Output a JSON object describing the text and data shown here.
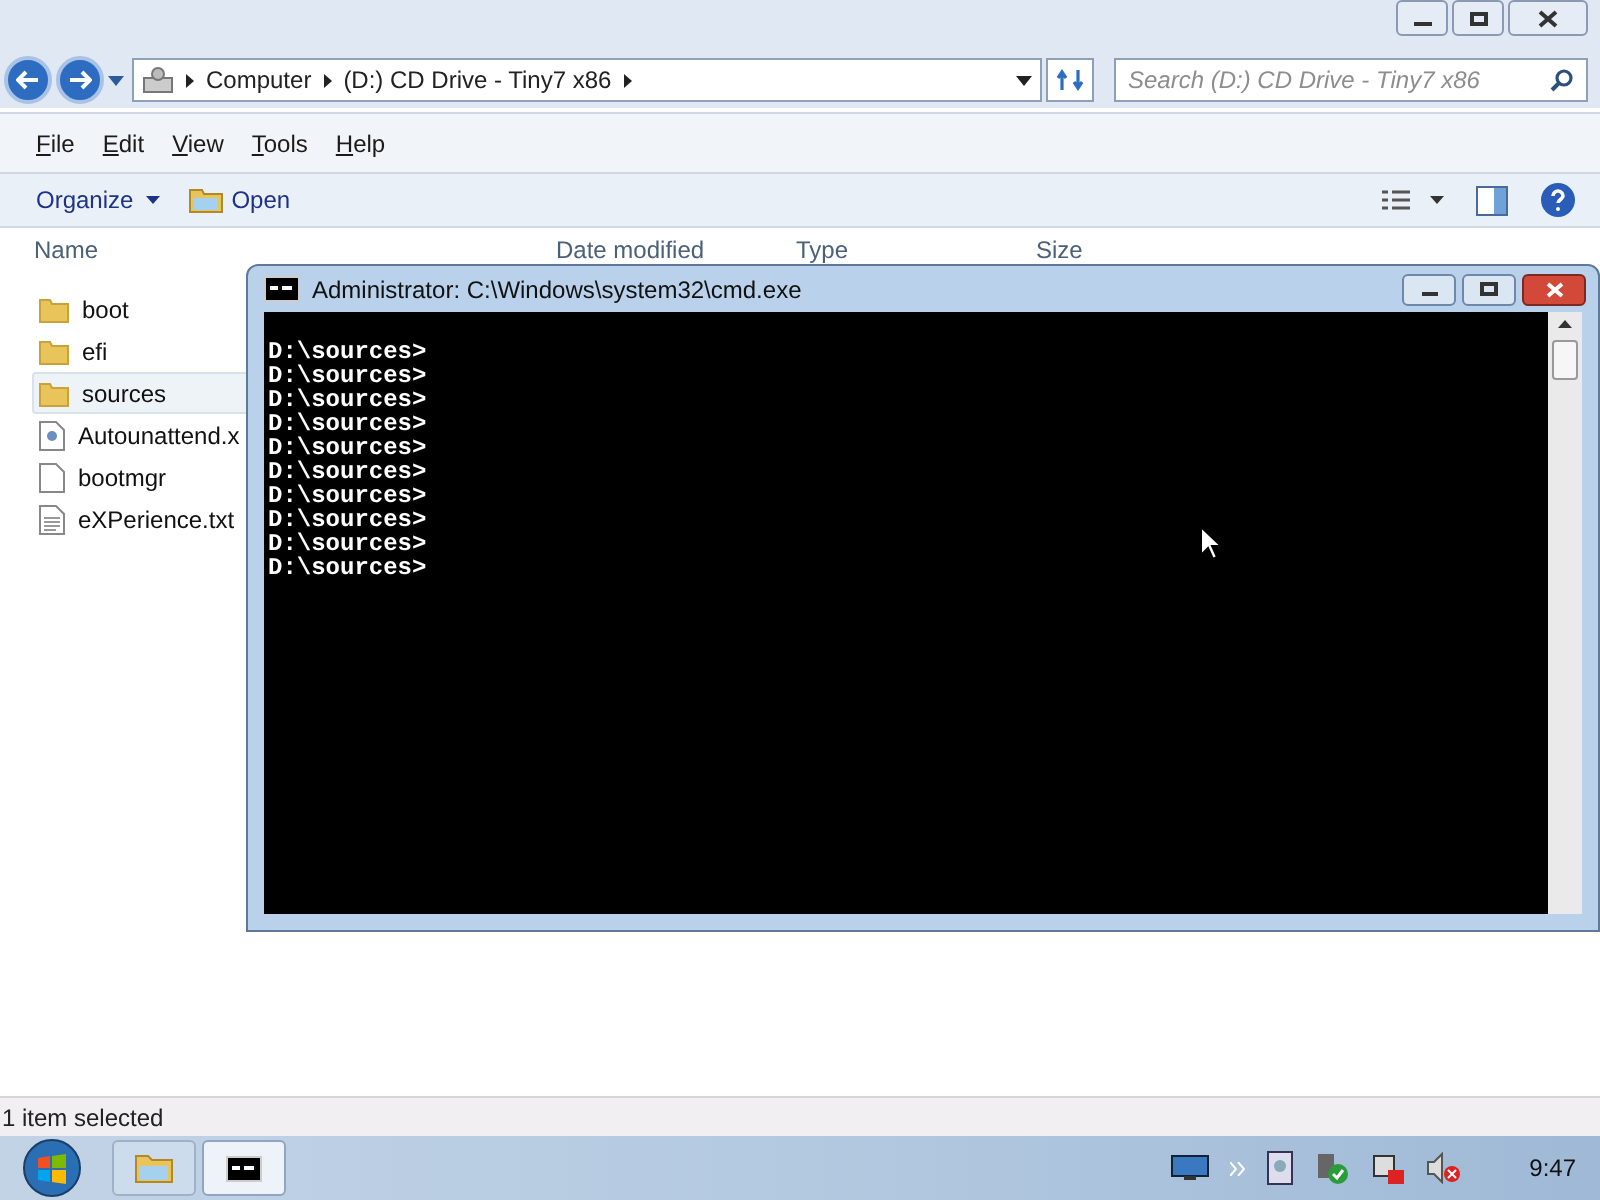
{
  "explorer": {
    "crumbs": [
      "Computer",
      "(D:) CD Drive - Tiny7 x86"
    ],
    "search": {
      "placeholder": "Search (D:) CD Drive - Tiny7 x86"
    },
    "menu": [
      "File",
      "Edit",
      "View",
      "Tools",
      "Help"
    ],
    "toolbar": {
      "organize": "Organize",
      "open": "Open"
    },
    "columns": [
      "Name",
      "Date modified",
      "Type",
      "Size"
    ],
    "files": [
      {
        "name": "boot",
        "kind": "folder",
        "selected": false
      },
      {
        "name": "efi",
        "kind": "folder",
        "selected": false
      },
      {
        "name": "sources",
        "kind": "folder",
        "selected": true
      },
      {
        "name": "Autounattend.x",
        "kind": "xml",
        "selected": false
      },
      {
        "name": "bootmgr",
        "kind": "file",
        "selected": false
      },
      {
        "name": "eXPerience.txt",
        "kind": "text",
        "selected": false
      }
    ],
    "status": "1 item selected"
  },
  "cmd": {
    "title": "Administrator: C:\\Windows\\system32\\cmd.exe",
    "lines": [
      "D:\\sources>",
      "D:\\sources>",
      "D:\\sources>",
      "D:\\sources>",
      "D:\\sources>",
      "D:\\sources>",
      "D:\\sources>",
      "D:\\sources>",
      "D:\\sources>",
      "D:\\sources>"
    ]
  },
  "taskbar": {
    "tasks": [
      {
        "kind": "explorer",
        "selected": false
      },
      {
        "kind": "cmd",
        "selected": true
      }
    ],
    "clock": "9:47"
  }
}
